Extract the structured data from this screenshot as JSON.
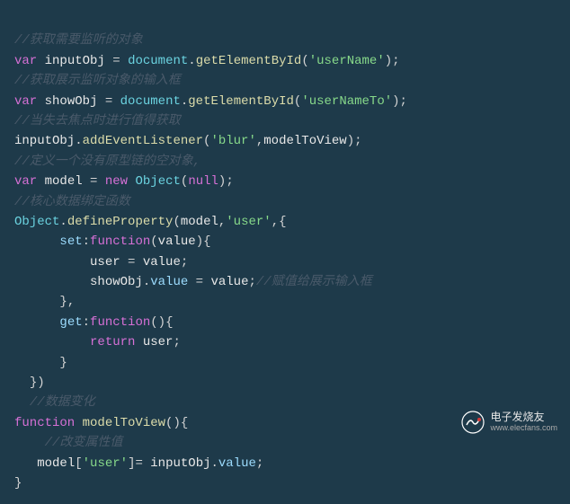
{
  "code": {
    "c1": "//获取需要监听的对象",
    "l2_kw": "var",
    "l2_v": "inputObj",
    "l2_eq": " = ",
    "l2_obj": "document",
    "l2_fn": "getElementById",
    "l2_str": "'userName'",
    "c3": "//获取展示监听对象的输入框",
    "l4_kw": "var",
    "l4_v": "showObj",
    "l4_eq": " = ",
    "l4_obj": "document",
    "l4_fn": "getElementById",
    "l4_str": "'userNameTo'",
    "c5": "//当失去焦点时进行值得获取",
    "l6_obj": "inputObj",
    "l6_fn": "addEventListener",
    "l6_str": "'blur'",
    "l6_arg": "modelToView",
    "c7": "//定义一个没有原型链的空对象,",
    "l8_kw": "var",
    "l8_v": "model",
    "l8_eq": " = ",
    "l8_new": "new",
    "l8_obj": "Object",
    "l8_arg": "null",
    "c9": "//核心数据绑定函数",
    "l10_obj": "Object",
    "l10_fn": "defineProperty",
    "l10_a1": "model",
    "l10_str": "'user'",
    "l11_key": "set",
    "l11_fn": "function",
    "l11_p": "value",
    "l12_a": "user",
    "l12_b": "value",
    "l13_a": "showObj",
    "l13_b": "value",
    "l13_c": "value",
    "l13_cmt": "//赋值给展示输入框",
    "l15_key": "get",
    "l15_fn": "function",
    "l16_ret": "return",
    "l16_v": "user",
    "c19": "//数据变化",
    "l20_kw": "function",
    "l20_fn": "modelToView",
    "c21": "//改变属性值",
    "l22_a": "model",
    "l22_str": "'user'",
    "l22_b": "inputObj",
    "l22_c": "value"
  },
  "watermark": {
    "title": "电子发烧友",
    "url": "www.elecfans.com"
  }
}
